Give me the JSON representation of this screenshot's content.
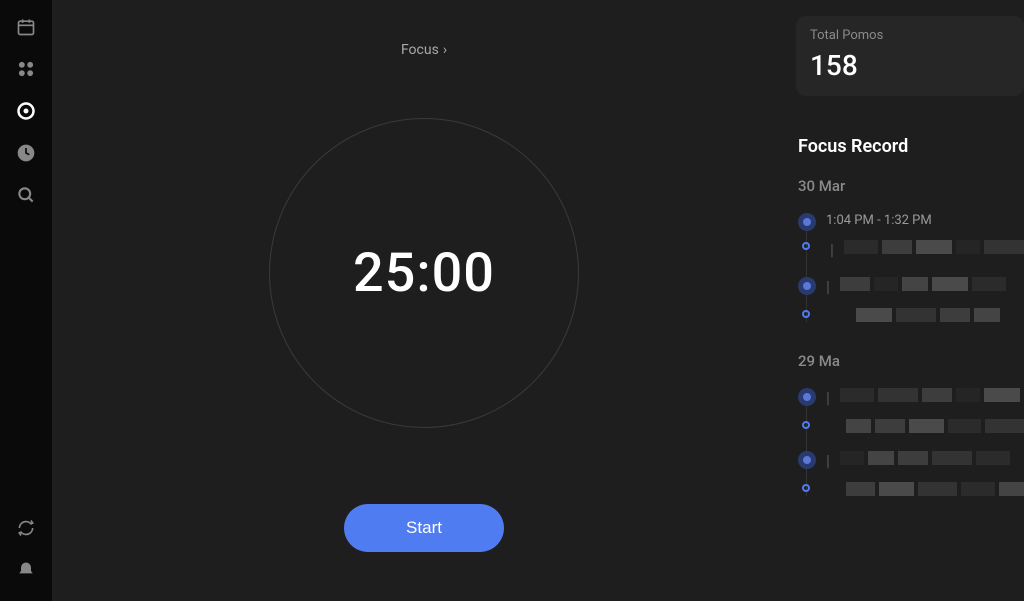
{
  "header": {
    "focus_label": "Focus"
  },
  "timer": {
    "value": "25:00",
    "start_label": "Start"
  },
  "stats": {
    "total_pomos_label": "Total Pomos",
    "total_pomos_value": "158"
  },
  "focus_record": {
    "title": "Focus Record",
    "days": [
      {
        "date": "30 Mar",
        "entries": [
          {
            "time": "1:04 PM - 1:32 PM"
          },
          {
            "time": ""
          }
        ]
      },
      {
        "date": "29 Ma",
        "entries": [
          {
            "time": ""
          },
          {
            "time": ""
          }
        ]
      }
    ]
  }
}
